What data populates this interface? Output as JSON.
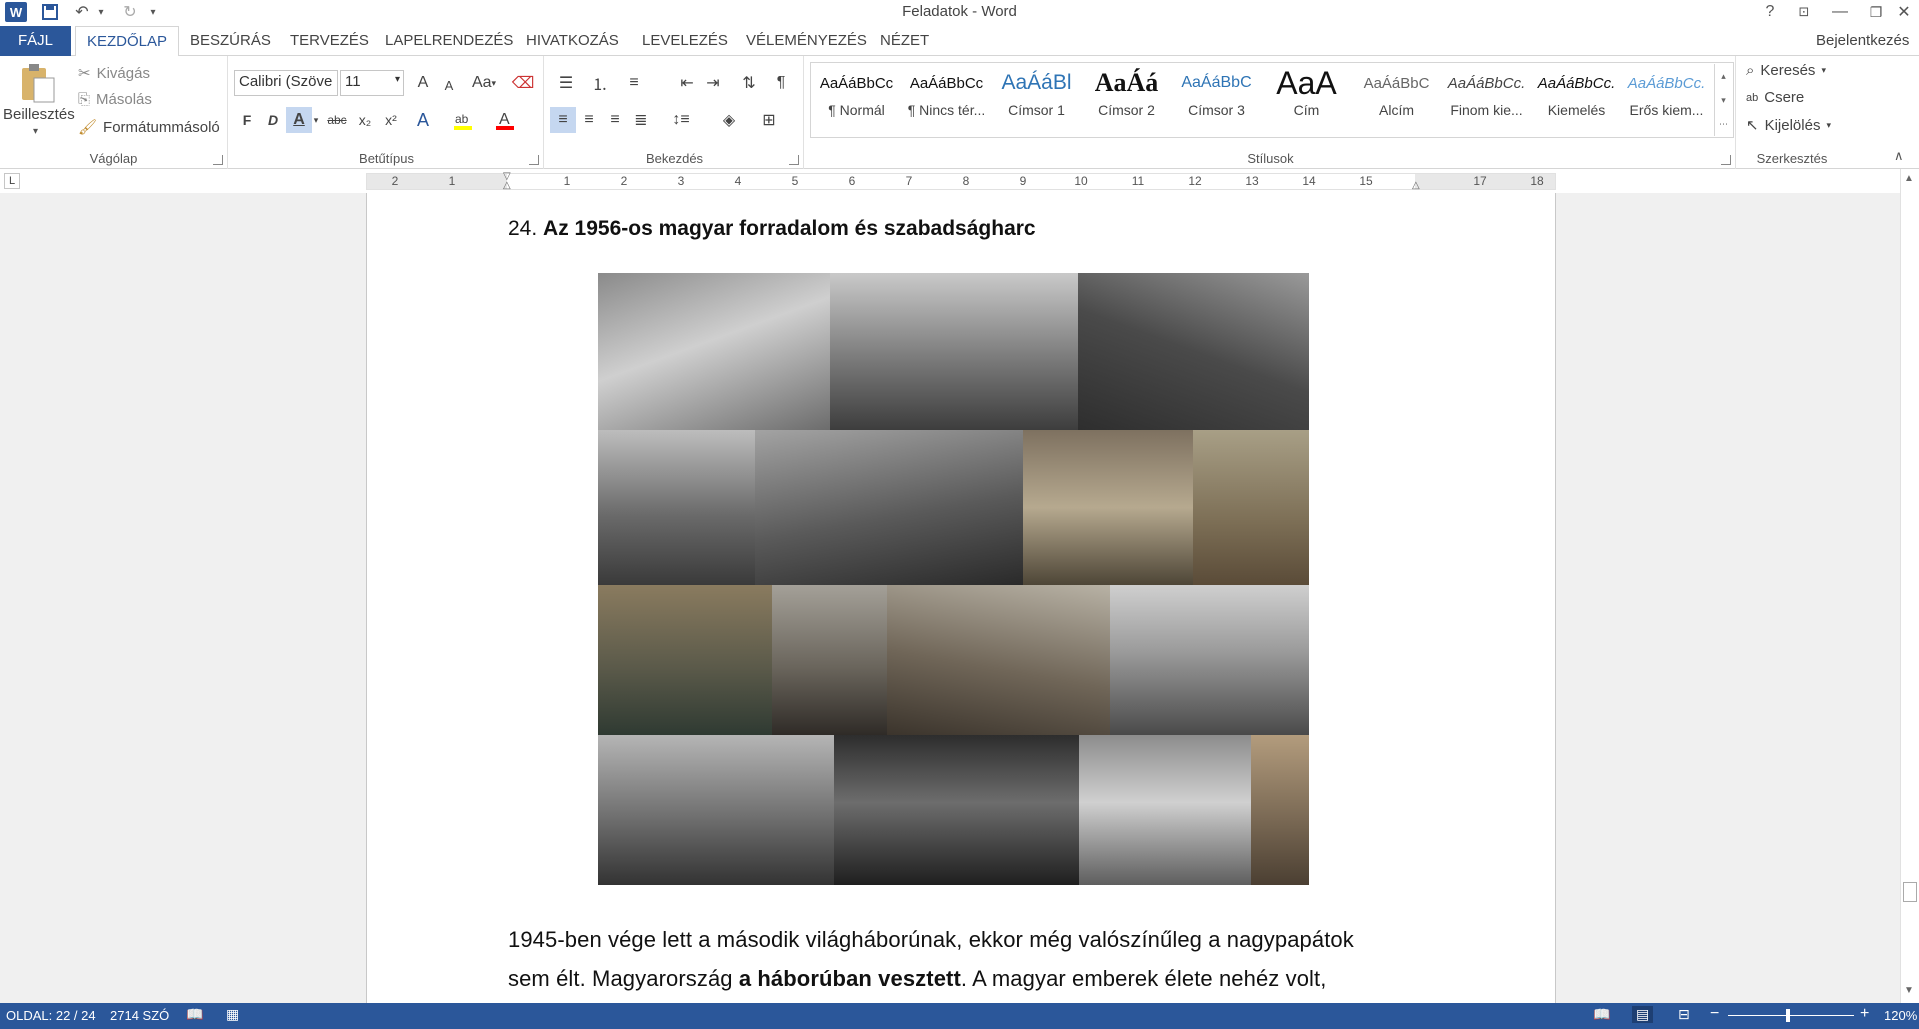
{
  "window": {
    "title": "Feladatok - Word",
    "help": "?",
    "signin": "Bejelentkezés"
  },
  "tabs": [
    "FÁJL",
    "KEZDŐLAP",
    "BESZÚRÁS",
    "TERVEZÉS",
    "LAPELRENDEZÉS",
    "HIVATKOZÁS",
    "LEVELEZÉS",
    "VÉLEMÉNYEZÉS",
    "NÉZET"
  ],
  "clipboard": {
    "paste": "Beillesztés",
    "cut": "Kivágás",
    "copy": "Másolás",
    "format_painter": "Formátummásoló",
    "label": "Vágólap"
  },
  "font": {
    "name": "Calibri (Szöve",
    "size": "11",
    "label": "Betűtípus",
    "bold": "F",
    "italic": "D",
    "underline": "A",
    "strike": "abc",
    "sub": "x₂",
    "sup": "x²",
    "case": "Aa",
    "grow": "A",
    "shrink": "A",
    "colors": {
      "highlight": "#ffff00",
      "font_color": "#ff0000",
      "accent": "#2b579a"
    }
  },
  "paragraph": {
    "label": "Bekezdés"
  },
  "styles": {
    "label": "Stílusok",
    "items": [
      {
        "preview": "AaÁáBbCc",
        "name": "¶ Normál"
      },
      {
        "preview": "AaÁáBbCc",
        "name": "¶ Nincs tér..."
      },
      {
        "preview": "AaÁáBl",
        "name": "Címsor 1"
      },
      {
        "preview": "AaÁá",
        "name": "Címsor 2"
      },
      {
        "preview": "AaÁáBbC",
        "name": "Címsor 3"
      },
      {
        "preview": "AaA",
        "name": "Cím"
      },
      {
        "preview": "AaÁáBbC",
        "name": "Alcím"
      },
      {
        "preview": "AaÁáBbCc.",
        "name": "Finom kie..."
      },
      {
        "preview": "AaÁáBbCc.",
        "name": "Kiemelés"
      },
      {
        "preview": "AaÁáBbCc.",
        "name": "Erős kiem..."
      }
    ]
  },
  "editing": {
    "find": "Keresés",
    "replace": "Csere",
    "select": "Kijelölés",
    "label": "Szerkesztés"
  },
  "ruler": {
    "numbers": [
      "2",
      "1",
      "1",
      "2",
      "3",
      "4",
      "5",
      "6",
      "7",
      "8",
      "9",
      "10",
      "11",
      "12",
      "13",
      "14",
      "15",
      "17",
      "18"
    ],
    "corner": "L"
  },
  "document": {
    "heading_number": "24.",
    "heading_text": "Az 1956-os magyar forradalom és szabadságharc",
    "para1_line1": "1945-ben vége lett a második világháborúnak, ekkor még valószínűleg a nagypapátok",
    "para1_line2_a": "sem élt. Magyarország ",
    "para1_line2_b": "a háborúban vesztett",
    "para1_line2_c": ". A magyar emberek élete nehéz volt,"
  },
  "status": {
    "page": "OLDAL: 22 / 24",
    "words": "2714 SZÓ",
    "zoom": "120%"
  }
}
